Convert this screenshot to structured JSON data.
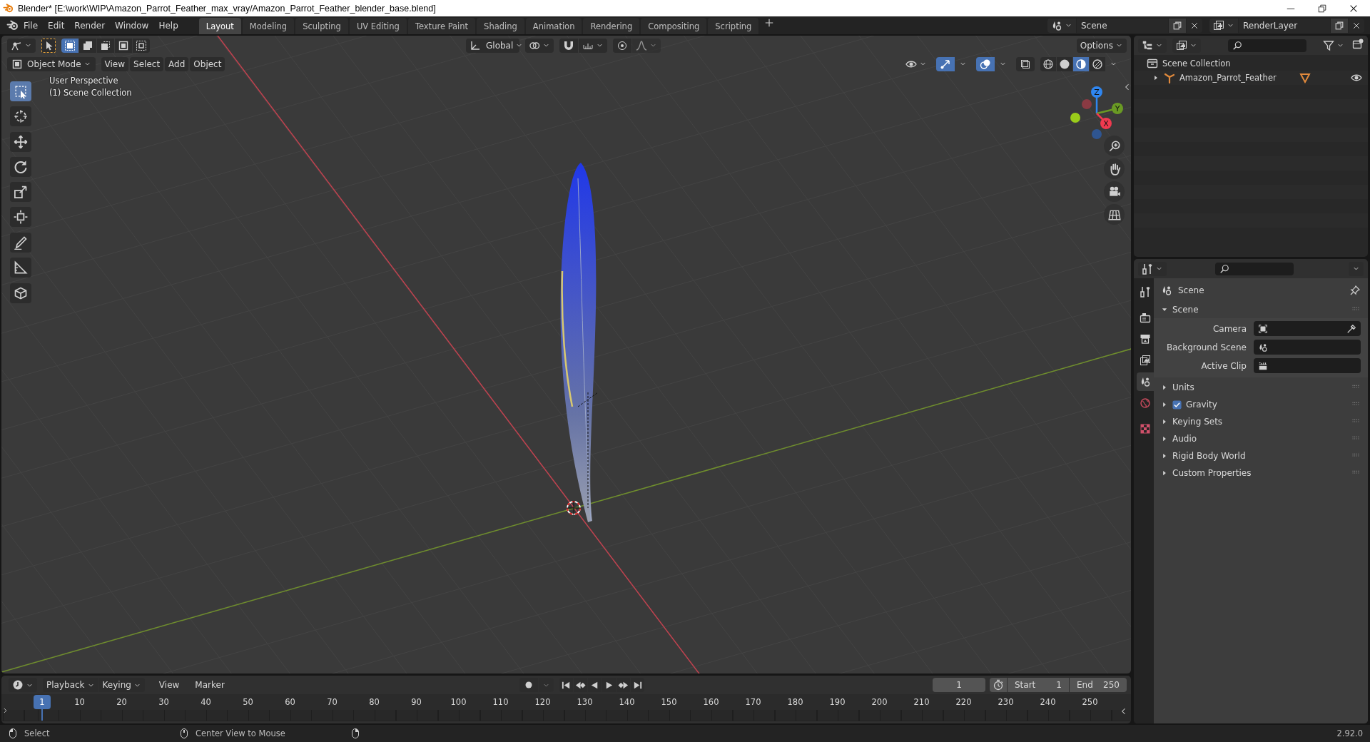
{
  "window": {
    "title": "Blender* [E:\\work\\WIP\\Amazon_Parrot_Feather_max_vray/Amazon_Parrot_Feather_blender_base.blend]"
  },
  "menu": [
    "File",
    "Edit",
    "Render",
    "Window",
    "Help"
  ],
  "workspaces": [
    {
      "label": "Layout",
      "selected": true
    },
    {
      "label": "Modeling",
      "selected": false
    },
    {
      "label": "Sculpting",
      "selected": false
    },
    {
      "label": "UV Editing",
      "selected": false
    },
    {
      "label": "Texture Paint",
      "selected": false
    },
    {
      "label": "Shading",
      "selected": false
    },
    {
      "label": "Animation",
      "selected": false
    },
    {
      "label": "Rendering",
      "selected": false
    },
    {
      "label": "Compositing",
      "selected": false
    },
    {
      "label": "Scripting",
      "selected": false
    }
  ],
  "scene_selector": {
    "value": "Scene"
  },
  "view_layer_selector": {
    "value": "RenderLayer"
  },
  "viewport": {
    "select_modes": [
      {
        "selected": true
      },
      {
        "selected": false
      },
      {
        "selected": false
      },
      {
        "selected": false
      },
      {
        "selected": false
      }
    ],
    "orientation": "Global",
    "options": "Options",
    "mode": "Object Mode",
    "menus": [
      "View",
      "Select",
      "Add",
      "Object"
    ],
    "toggles": [
      {
        "kind": "gizmos",
        "on": true
      },
      {
        "kind": "overlays",
        "on": true
      },
      {
        "kind": "xray",
        "on": false
      }
    ],
    "shading": [
      {
        "kind": "wireframe",
        "selected": false
      },
      {
        "kind": "solid",
        "selected": false
      },
      {
        "kind": "material",
        "selected": true
      },
      {
        "kind": "rendered",
        "selected": false
      }
    ],
    "overlay_text": [
      "User Perspective",
      "(1) Scene Collection"
    ],
    "tool_groups": [
      [
        {
          "kind": "select",
          "selected": true
        },
        {
          "kind": "cursor",
          "selected": false
        }
      ],
      [
        {
          "kind": "move",
          "selected": false
        },
        {
          "kind": "rotate",
          "selected": false
        },
        {
          "kind": "scale",
          "selected": false
        },
        {
          "kind": "transform",
          "selected": false
        }
      ],
      [
        {
          "kind": "annotate",
          "selected": false
        },
        {
          "kind": "measure",
          "selected": false
        }
      ],
      [
        {
          "kind": "add_cube",
          "selected": false
        }
      ]
    ],
    "gizmo_axes": [
      "X",
      "Y",
      "Z"
    ]
  },
  "outliner": {
    "root": "Scene Collection",
    "items": [
      {
        "label": "Amazon_Parrot_Feather",
        "expanded": false,
        "visible": true
      }
    ]
  },
  "properties": {
    "tabs": [
      {
        "kind": "tool",
        "selected": false
      },
      {
        "kind": "render",
        "selected": false
      },
      {
        "kind": "output",
        "selected": false
      },
      {
        "kind": "view_layer",
        "selected": false
      },
      {
        "kind": "scene",
        "selected": true
      },
      {
        "kind": "world",
        "selected": false
      },
      {
        "kind": "texture",
        "selected": false
      }
    ],
    "context": "Scene",
    "panels": [
      {
        "title": "Scene",
        "expanded": true,
        "fields": [
          {
            "label": "Camera",
            "kind": "camera"
          },
          {
            "label": "Background Scene",
            "kind": "scene"
          },
          {
            "label": "Active Clip",
            "kind": "clip"
          }
        ]
      },
      {
        "title": "Units",
        "expanded": false
      },
      {
        "title": "Gravity",
        "expanded": false,
        "checked": true
      },
      {
        "title": "Keying Sets",
        "expanded": false
      },
      {
        "title": "Audio",
        "expanded": false
      },
      {
        "title": "Rigid Body World",
        "expanded": false
      },
      {
        "title": "Custom Properties",
        "expanded": false
      }
    ]
  },
  "timeline": {
    "menus": [
      {
        "label": "Playback",
        "kind": "dropdown"
      },
      {
        "label": "Keying",
        "kind": "dropdown"
      },
      {
        "label": "View",
        "kind": "menu"
      },
      {
        "label": "Marker",
        "kind": "menu"
      }
    ],
    "current_frame": "1",
    "start_label": "Start",
    "start": "1",
    "end_label": "End",
    "end": "250",
    "playhead": "1",
    "ruler": [
      "10",
      "20",
      "30",
      "40",
      "50",
      "60",
      "70",
      "80",
      "90",
      "100",
      "110",
      "120",
      "130",
      "140",
      "150",
      "160",
      "170",
      "180",
      "190",
      "200",
      "210",
      "220",
      "230",
      "240",
      "250"
    ]
  },
  "status_bar": {
    "hints": [
      "Select",
      "Center View to Mouse"
    ],
    "version": "2.92.0"
  }
}
